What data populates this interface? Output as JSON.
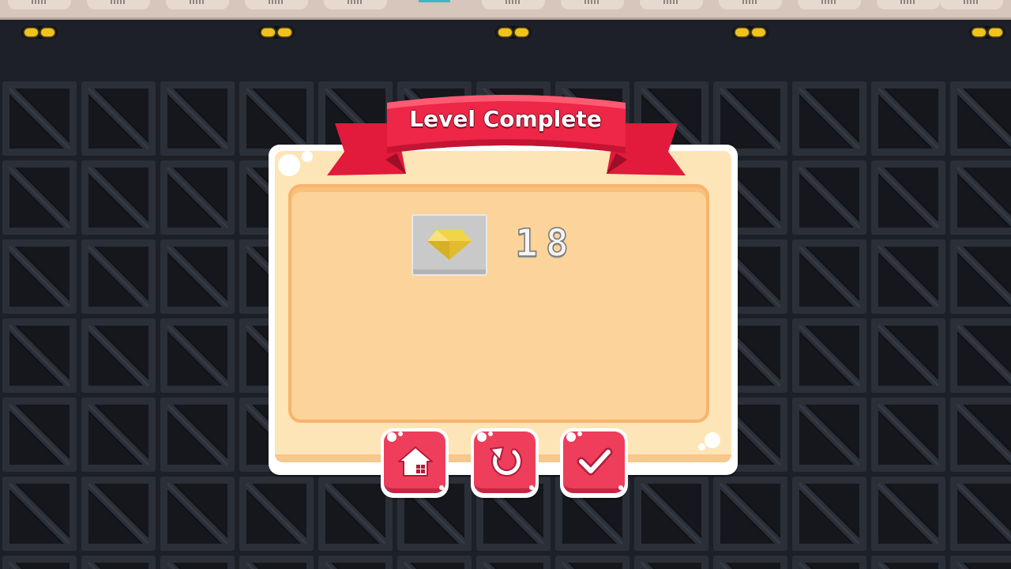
{
  "dialog": {
    "title": "Level Complete",
    "reward": {
      "icon": "yellow-gem-icon",
      "value": "18"
    }
  },
  "buttons": {
    "home": {
      "icon": "home-icon"
    },
    "replay": {
      "icon": "replay-icon"
    },
    "confirm": {
      "icon": "checkmark-icon"
    }
  },
  "colors": {
    "ribbon": "#e8203f",
    "button": "#ee3e5c",
    "panel": "#fde5b7",
    "panel_inner": "#fcd39a",
    "gem": "#f2d449",
    "background": "#1c1f26"
  }
}
